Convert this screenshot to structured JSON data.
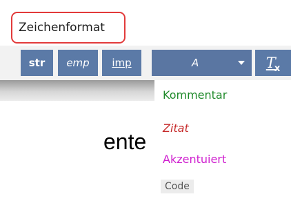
{
  "section": {
    "label": "Zeichenformat"
  },
  "toolbar": {
    "strong": "str",
    "emphasis": "emp",
    "important": "imp",
    "font_selector": "A",
    "clear_format_letter": "T",
    "clear_format_sub": "x"
  },
  "editor": {
    "text_fragment": "ente"
  },
  "dropdown": {
    "items": [
      {
        "label": "Kommentar",
        "color": "#1f8a2a"
      },
      {
        "label": "Zitat",
        "color": "#c62a2a"
      },
      {
        "label": "Akzentuiert",
        "color": "#cf1fcf"
      },
      {
        "label": "Code",
        "color": "#555555"
      }
    ]
  },
  "colors": {
    "accent": "#5b7aa7",
    "highlight_border": "#e23a3a"
  }
}
